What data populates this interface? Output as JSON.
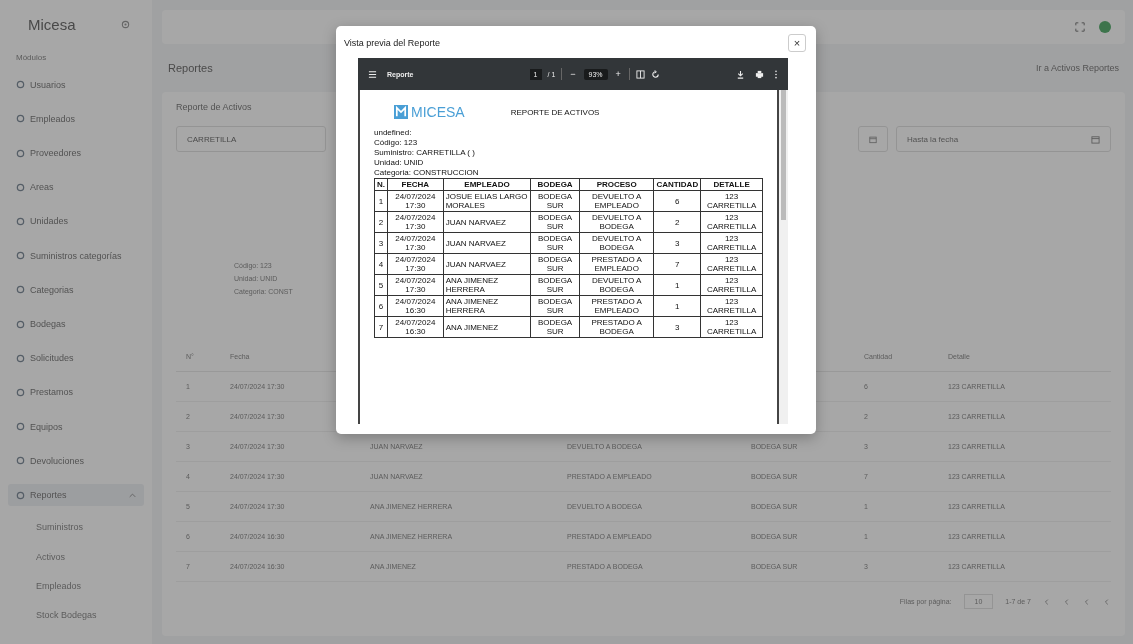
{
  "sidebar": {
    "brand": "Micesa",
    "section": "Módulos",
    "items": [
      {
        "label": "Usuarios"
      },
      {
        "label": "Empleados"
      },
      {
        "label": "Proveedores"
      },
      {
        "label": "Areas"
      },
      {
        "label": "Unidades"
      },
      {
        "label": "Suministros categorías"
      },
      {
        "label": "Categorias"
      },
      {
        "label": "Bodegas"
      },
      {
        "label": "Solicitudes"
      },
      {
        "label": "Prestamos"
      },
      {
        "label": "Equipos"
      },
      {
        "label": "Devoluciones"
      },
      {
        "label": "Reportes",
        "expanded": true,
        "children": [
          {
            "label": "Suministros"
          },
          {
            "label": "Activos"
          },
          {
            "label": "Empleados"
          },
          {
            "label": "Stock Bodegas"
          }
        ]
      }
    ]
  },
  "page": {
    "title": "Reportes",
    "action": "Ir a Activos Reportes",
    "card_title": "Reporte de Activos",
    "supply_field": "CARRETILLA",
    "date_placeholder": "Hasta la fecha",
    "info": [
      "Código: 123",
      "Unidad: UNID",
      "Categoria: CONST"
    ],
    "table": {
      "columns": [
        "N°",
        "Fecha",
        null,
        null,
        null,
        "Cantidad",
        "Detalle"
      ],
      "rows": [
        [
          "1",
          "24/07/2024 17:30",
          null,
          null,
          null,
          "6",
          "123 CARRETILLA"
        ],
        [
          "2",
          "24/07/2024 17:30",
          null,
          null,
          null,
          "2",
          "123 CARRETILLA"
        ],
        [
          "3",
          "24/07/2024 17:30",
          "JUAN NARVAEZ",
          "DEVUELTO A BODEGA",
          "BODEGA SUR",
          "3",
          "123 CARRETILLA"
        ],
        [
          "4",
          "24/07/2024 17:30",
          "JUAN NARVAEZ",
          "PRESTADO A EMPLEADO",
          "BODEGA SUR",
          "7",
          "123 CARRETILLA"
        ],
        [
          "5",
          "24/07/2024 17:30",
          "ANA JIMENEZ HERRERA",
          "DEVUELTO A BODEGA",
          "BODEGA SUR",
          "1",
          "123 CARRETILLA"
        ],
        [
          "6",
          "24/07/2024 16:30",
          "ANA JIMENEZ HERRERA",
          "PRESTADO A EMPLEADO",
          "BODEGA SUR",
          "1",
          "123 CARRETILLA"
        ],
        [
          "7",
          "24/07/2024 16:30",
          "ANA JIMENEZ",
          "PRESTADO A BODEGA",
          "BODEGA SUR",
          "3",
          "123 CARRETILLA"
        ]
      ]
    },
    "rows_per_page_label": "Filas por página:",
    "rows_per_page": "10",
    "range": "1-7 de 7"
  },
  "modal": {
    "title": "Vista previa del Reporte",
    "close": "×",
    "viewer": {
      "doc_name": "Reporte",
      "page": "1",
      "page_total": "/ 1",
      "zoom": "93%",
      "zoom_out": "−",
      "zoom_in": "+"
    },
    "document": {
      "brand": "MICESA",
      "title": "REPORTE DE ACTIVOS",
      "meta": [
        "undefined:",
        "Código: 123",
        "Suministro: CARRETILLA ( )",
        "Unidad: UNID",
        "Categoria: CONSTRUCCION"
      ],
      "columns": [
        "N.",
        "FECHA",
        "EMPLEADO",
        "BODEGA",
        "PROCESO",
        "CANTIDAD",
        "DETALLE"
      ],
      "rows": [
        [
          "1",
          "24/07/2024 17:30",
          "JOSUE ELIAS LARGO MORALES",
          "BODEGA SUR",
          "DEVUELTO A EMPLEADO",
          "6",
          "123 CARRETILLA"
        ],
        [
          "2",
          "24/07/2024 17:30",
          "JUAN NARVAEZ",
          "BODEGA SUR",
          "DEVUELTO A BODEGA",
          "2",
          "123 CARRETILLA"
        ],
        [
          "3",
          "24/07/2024 17:30",
          "JUAN NARVAEZ",
          "BODEGA SUR",
          "DEVUELTO A BODEGA",
          "3",
          "123 CARRETILLA"
        ],
        [
          "4",
          "24/07/2024 17:30",
          "JUAN NARVAEZ",
          "BODEGA SUR",
          "PRESTADO A EMPLEADO",
          "7",
          "123 CARRETILLA"
        ],
        [
          "5",
          "24/07/2024 17:30",
          "ANA JIMENEZ HERRERA",
          "BODEGA SUR",
          "DEVUELTO A BODEGA",
          "1",
          "123 CARRETILLA"
        ],
        [
          "6",
          "24/07/2024 16:30",
          "ANA JIMENEZ HERRERA",
          "BODEGA SUR",
          "PRESTADO A EMPLEADO",
          "1",
          "123 CARRETILLA"
        ],
        [
          "7",
          "24/07/2024 16:30",
          "ANA JIMENEZ",
          "BODEGA SUR",
          "PRESTADO A BODEGA",
          "3",
          "123 CARRETILLA"
        ]
      ]
    }
  }
}
